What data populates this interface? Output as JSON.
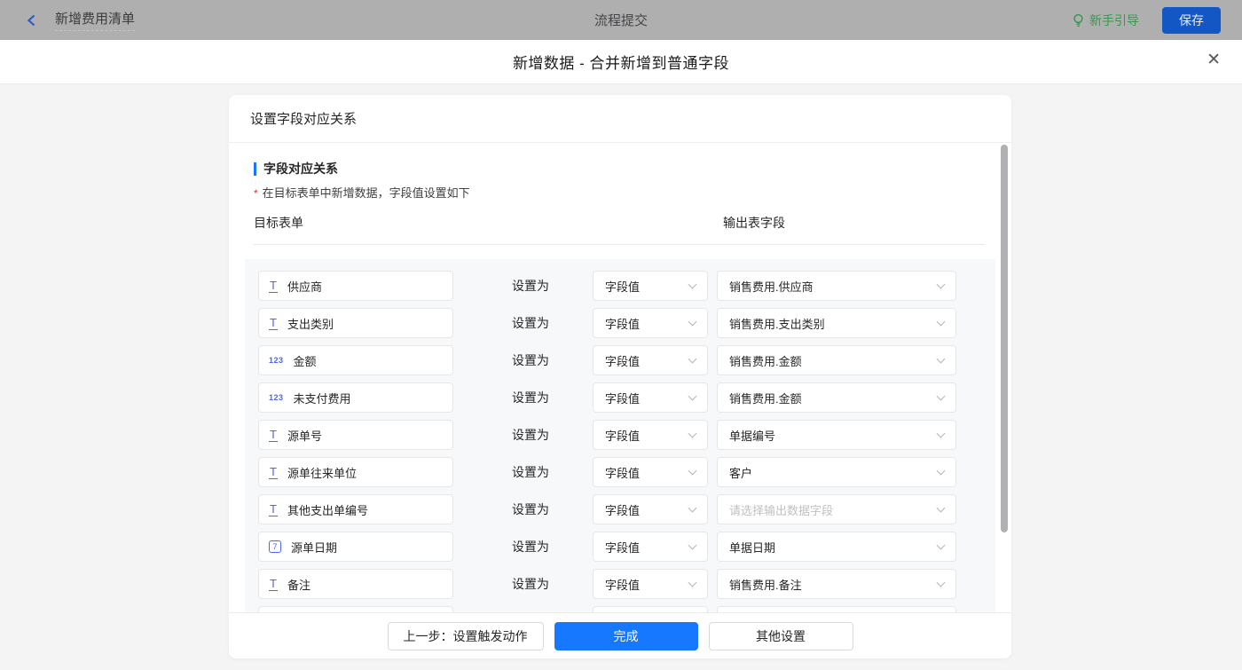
{
  "topbar": {
    "back_label": "新增费用清单",
    "center_title": "流程提交",
    "guide_label": "新手引导",
    "save_label": "保存"
  },
  "modal": {
    "title": "新增数据 - 合并新增到普通字段",
    "close_glyph": "✕"
  },
  "card": {
    "header": "设置字段对应关系",
    "section_title": "字段对应关系",
    "note_asterisk": "*",
    "note_text": "在目标表单中新增数据，字段值设置如下",
    "col_left": "目标表单",
    "col_right": "输出表字段"
  },
  "table": {
    "rows": [
      {
        "icon_type": "text",
        "icon_glyph": "T",
        "field": "供应商",
        "setter": "设置为",
        "value": "字段值",
        "output": "销售费用.供应商"
      },
      {
        "icon_type": "text",
        "icon_glyph": "T",
        "field": "支出类别",
        "setter": "设置为",
        "value": "字段值",
        "output": "销售费用.支出类别"
      },
      {
        "icon_type": "number",
        "icon_glyph": "123",
        "field": "金额",
        "setter": "设置为",
        "value": "字段值",
        "output": "销售费用.金额"
      },
      {
        "icon_type": "number",
        "icon_glyph": "123",
        "field": "未支付费用",
        "setter": "设置为",
        "value": "字段值",
        "output": "销售费用.金额"
      },
      {
        "icon_type": "text",
        "icon_glyph": "T",
        "field": "源单号",
        "setter": "设置为",
        "value": "字段值",
        "output": "单据编号"
      },
      {
        "icon_type": "text",
        "icon_glyph": "T",
        "field": "源单往来单位",
        "setter": "设置为",
        "value": "字段值",
        "output": "客户"
      },
      {
        "icon_type": "text",
        "icon_glyph": "T",
        "field": "其他支出单编号",
        "setter": "设置为",
        "value": "字段值",
        "output": "请选择输出数据字段",
        "is_placeholder": "true"
      },
      {
        "icon_type": "date",
        "icon_glyph": "7",
        "field": "源单日期",
        "setter": "设置为",
        "value": "字段值",
        "output": "单据日期"
      },
      {
        "icon_type": "text",
        "icon_glyph": "T",
        "field": "备注",
        "setter": "设置为",
        "value": "字段值",
        "output": "销售费用.备注"
      }
    ],
    "partial_row_visible": true
  },
  "footer": {
    "prev_label": "上一步：设置触发动作",
    "done_label": "完成",
    "other_label": "其他设置"
  },
  "colors": {
    "accent": "#1677ff",
    "guide_green": "#369a4e",
    "placeholder": "#c0c0c2",
    "topbar_dimmed": "#afafaf"
  }
}
